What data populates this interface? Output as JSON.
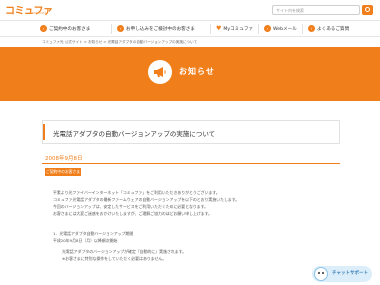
{
  "header": {
    "logo": "コミュファ",
    "logo_sub": "commufa",
    "search_placeholder": "サイト内を検索"
  },
  "nav": {
    "items": [
      {
        "label": "ご契約中のお客さま"
      },
      {
        "label": "お申し込みをご検討中のお客さま"
      },
      {
        "label": "Myコミュファ"
      },
      {
        "label": "Webメール"
      },
      {
        "label": "よくあるご質問"
      }
    ]
  },
  "breadcrumb": "コミュファ光 公式サイト > お知らせ > 光電話アダプタの自動バージョンアップの実施について",
  "banner": {
    "title": "お知らせ"
  },
  "article": {
    "title": "光電話アダプタの自動バージョンアップの実施について",
    "date": "2008年9月8日",
    "tag": "ご契約中のお客さま",
    "lines": [
      "平素より光ファイバーインターネット「コミュファ」をご利用いただきありがとうございます。",
      "コミュファ光電話アダプタの最新ファームウェアの自動バージョンアップを以下のとおり実施いたします。",
      "今回のバージョンアップは、安定したサービスをご利用いただくために必要となります。",
      "お客さまには大変ご迷惑をおかけいたしますが、ご理解ご協力のほどお願い申し上げます。",
      "",
      "1．光電話アダプタ自動バージョンアップ期間",
      "平成20年9月8日（月）以降順次開始",
      "光電話アダプタのバージョンアップが確定『自動的に』実施されます。",
      "※お客さまに特別な操作をしていただく必要はありません。"
    ]
  },
  "chatbot": {
    "label": "チャットサポート"
  },
  "colors": {
    "accent": "#f07e1a"
  }
}
